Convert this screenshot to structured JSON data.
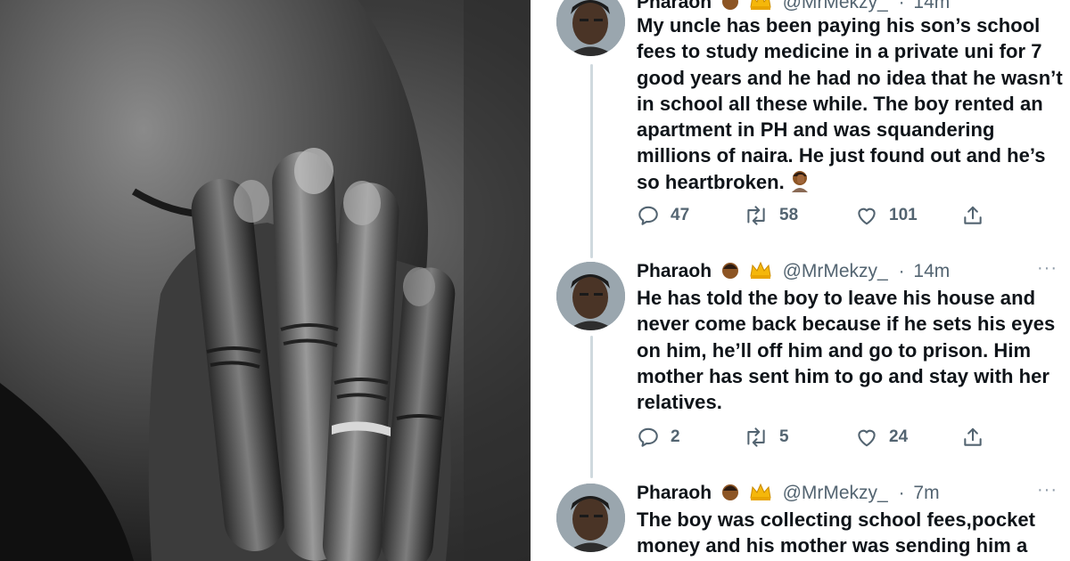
{
  "photo": {
    "subject": "man-covering-face"
  },
  "tweets": [
    {
      "name": "Pharaoh",
      "handle": "@MrMekzy_",
      "time": "14m",
      "text": "My uncle has been paying his son’s school fees to study medicine in a private uni for 7 good years and he had no idea that he wasn’t in school all these while. The boy rented an apartment in PH and was squandering millions of naira. He just found out and he’s so heartbroken.",
      "replies": "47",
      "retweets": "58",
      "likes": "101"
    },
    {
      "name": "Pharaoh",
      "handle": "@MrMekzy_",
      "time": "14m",
      "text": "He has told the boy to leave his house and never come back because if he sets his eyes on him, he’ll off him and go to prison. Him mother has sent him to go and stay with her relatives.",
      "replies": "2",
      "retweets": "5",
      "likes": "24"
    },
    {
      "name": "Pharaoh",
      "handle": "@MrMekzy_",
      "time": "7m",
      "text": "The boy was collecting school fees,pocket money and his mother was sending him a"
    }
  ],
  "more_label": "···",
  "separator": "·",
  "colors": {
    "text": "#0f1419",
    "muted": "#536471",
    "thread": "#cfd9de"
  },
  "icons": [
    "reply-icon",
    "retweet-icon",
    "like-icon",
    "share-icon",
    "man-emoji-icon",
    "crown-emoji-icon"
  ]
}
